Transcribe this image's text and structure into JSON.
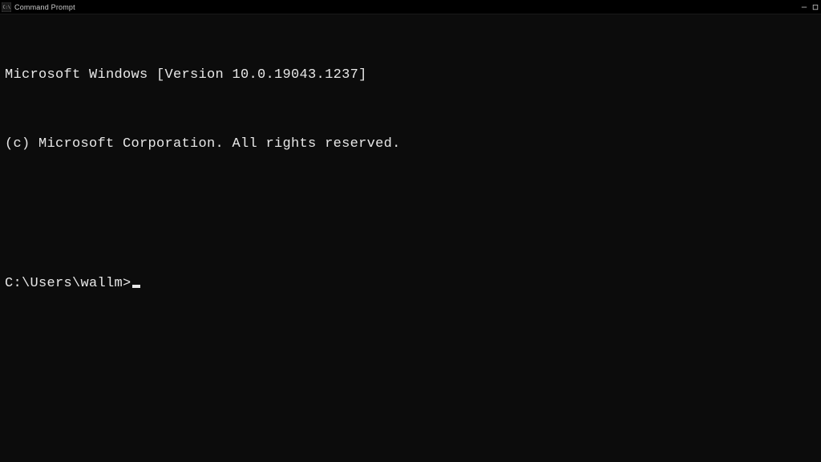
{
  "window": {
    "title": "Command Prompt"
  },
  "terminal": {
    "line1": "Microsoft Windows [Version 10.0.19043.1237]",
    "line2": "(c) Microsoft Corporation. All rights reserved.",
    "prompt": "C:\\Users\\wallm>"
  }
}
